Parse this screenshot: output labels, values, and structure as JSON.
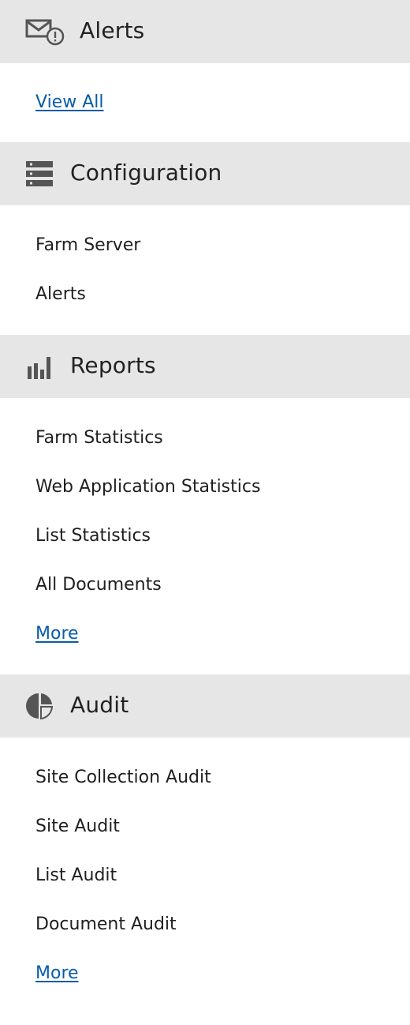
{
  "sections": [
    {
      "title": "Alerts",
      "icon": "mail-alert-icon",
      "items": [
        {
          "label": "View All",
          "is_link": true
        }
      ]
    },
    {
      "title": "Configuration",
      "icon": "server-rack-icon",
      "items": [
        {
          "label": "Farm Server",
          "is_link": false
        },
        {
          "label": "Alerts",
          "is_link": false
        }
      ]
    },
    {
      "title": "Reports",
      "icon": "bar-chart-icon",
      "items": [
        {
          "label": "Farm Statistics",
          "is_link": false
        },
        {
          "label": "Web Application Statistics",
          "is_link": false
        },
        {
          "label": "List Statistics",
          "is_link": false
        },
        {
          "label": "All Documents",
          "is_link": false
        },
        {
          "label": "More",
          "is_link": true
        }
      ]
    },
    {
      "title": "Audit",
      "icon": "pie-chart-icon",
      "items": [
        {
          "label": "Site Collection Audit",
          "is_link": false
        },
        {
          "label": "Site Audit",
          "is_link": false
        },
        {
          "label": "List Audit",
          "is_link": false
        },
        {
          "label": "Document Audit",
          "is_link": false
        },
        {
          "label": "More",
          "is_link": true
        }
      ]
    }
  ],
  "colors": {
    "header_bg": "#e6e6e7",
    "link": "#0a5ca8",
    "icon": "#555555"
  }
}
